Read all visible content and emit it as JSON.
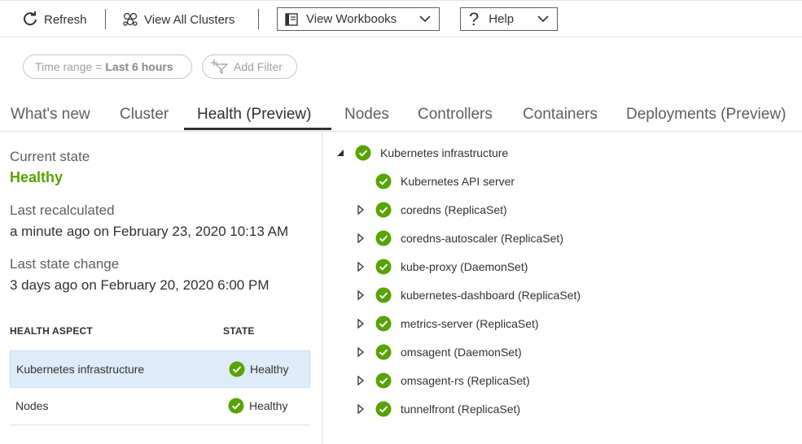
{
  "toolbar": {
    "refresh_label": "Refresh",
    "view_all_clusters_label": "View All Clusters",
    "view_workbooks_label": "View Workbooks",
    "help_label": "Help"
  },
  "filters": {
    "time_range_label": "Time range =",
    "time_range_value": "Last 6 hours",
    "add_filter_label": "Add Filter"
  },
  "tabs": [
    {
      "label": "What's new"
    },
    {
      "label": "Cluster"
    },
    {
      "label": "Health (Preview)",
      "active": true
    },
    {
      "label": "Nodes"
    },
    {
      "label": "Controllers"
    },
    {
      "label": "Containers"
    },
    {
      "label": "Deployments (Preview)"
    }
  ],
  "summary": {
    "current_state_label": "Current state",
    "current_state_value": "Healthy",
    "last_recalculated_label": "Last recalculated",
    "last_recalculated_value": "a minute ago on February 23, 2020 10:13 AM",
    "last_state_change_label": "Last state change",
    "last_state_change_value": "3 days ago on February 20, 2020 6:00 PM"
  },
  "aspects_table": {
    "headers": [
      "HEALTH ASPECT",
      "STATE"
    ],
    "rows": [
      {
        "aspect": "Kubernetes infrastructure",
        "state": "Healthy",
        "selected": true
      },
      {
        "aspect": "Nodes",
        "state": "Healthy",
        "selected": false
      }
    ]
  },
  "tree": {
    "root": {
      "label": "Kubernetes infrastructure",
      "expanded": true
    },
    "children": [
      {
        "label": "Kubernetes API server",
        "expandable": false
      },
      {
        "label": "coredns (ReplicaSet)",
        "expandable": true
      },
      {
        "label": "coredns-autoscaler (ReplicaSet)",
        "expandable": true
      },
      {
        "label": "kube-proxy (DaemonSet)",
        "expandable": true
      },
      {
        "label": "kubernetes-dashboard (ReplicaSet)",
        "expandable": true
      },
      {
        "label": "metrics-server (ReplicaSet)",
        "expandable": true
      },
      {
        "label": "omsagent (DaemonSet)",
        "expandable": true
      },
      {
        "label": "omsagent-rs (ReplicaSet)",
        "expandable": true
      },
      {
        "label": "tunnelfront (ReplicaSet)",
        "expandable": true
      }
    ]
  },
  "colors": {
    "healthy": "#57a300",
    "selected_row": "#deecf9"
  }
}
